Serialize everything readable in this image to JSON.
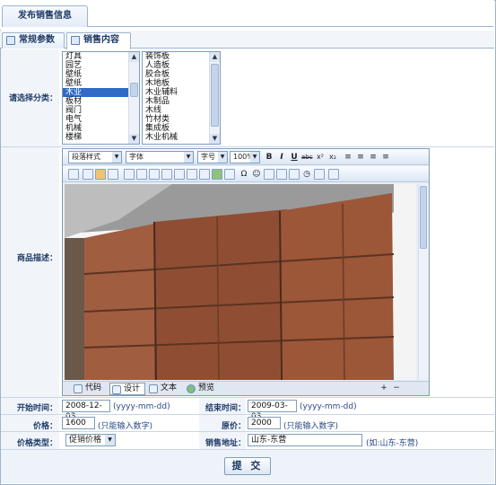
{
  "header": {
    "title": "发布销售信息"
  },
  "tabs": [
    {
      "label": "常规参数",
      "active": false
    },
    {
      "label": "销售内容",
      "active": true
    }
  ],
  "category": {
    "label": "请选择分类：",
    "list1": [
      "灯具",
      "园艺",
      "壁纸",
      "壁纸",
      "木业",
      "板材",
      "阀门",
      "电气",
      "机械",
      "楼梯"
    ],
    "list1_selected": "木业",
    "list2": [
      "装饰板",
      "人造板",
      "胶合板",
      "木地板",
      "木业辅料",
      "木制品",
      "木线",
      "竹材类",
      "集成板",
      "木业机械"
    ]
  },
  "description": {
    "label": "商品描述：",
    "toolbar": {
      "paragraph": "段落样式",
      "font": "字体",
      "size": "字号",
      "zoom": "100%"
    },
    "modes": [
      {
        "label": "代码",
        "icon": "code-icon",
        "active": false
      },
      {
        "label": "设计",
        "icon": "design-icon",
        "active": true
      },
      {
        "label": "文本",
        "icon": "text-icon",
        "active": false
      },
      {
        "label": "预览",
        "icon": "preview-icon",
        "active": false
      }
    ]
  },
  "form": {
    "start_label": "开始时间：",
    "start_value": "2008-12-03",
    "date_hint": "(yyyy-mm-dd)",
    "end_label": "结束时间：",
    "end_value": "2009-03-03",
    "price_label": "价格：",
    "price_value": "1600",
    "number_hint": "(只能输入数字)",
    "orig_label": "原价：",
    "orig_value": "2000",
    "ptype_label": "价格类型：",
    "ptype_value": "促销价格",
    "addr_label": "销售地址：",
    "addr_value": "山东-东营",
    "addr_hint": "(如:山东-东营)"
  },
  "submit_label": "提 交"
}
